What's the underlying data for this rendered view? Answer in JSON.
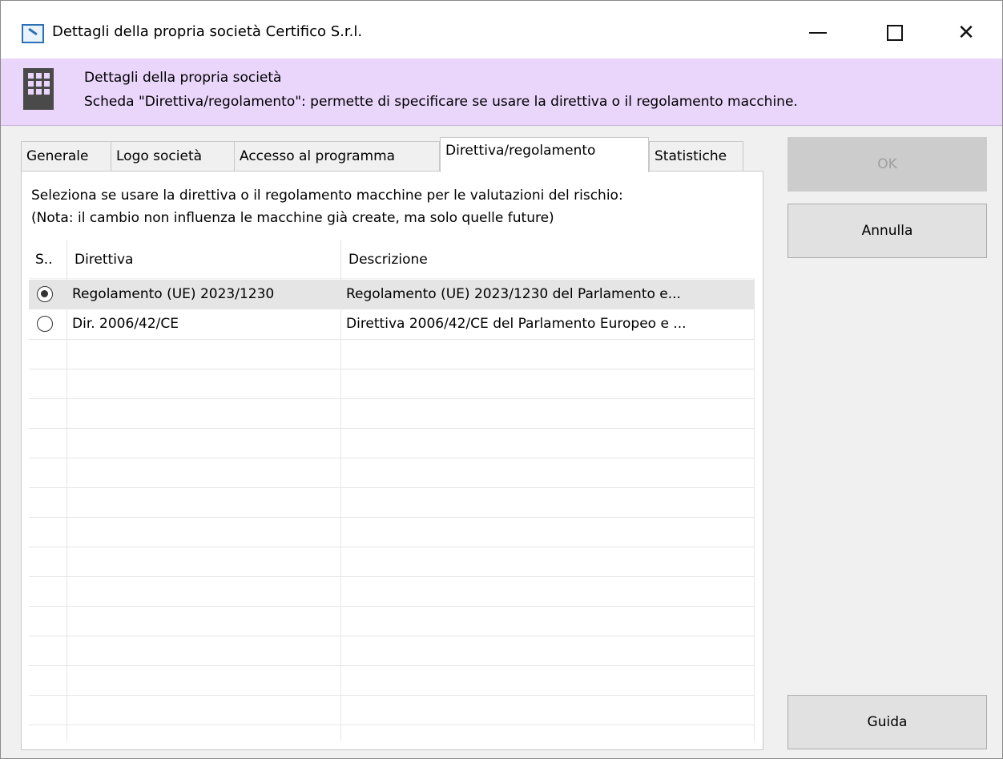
{
  "window": {
    "title": "Dettagli della propria società Certifico S.r.l.",
    "minimize_icon": "minimize-icon",
    "maximize_icon": "maximize-icon",
    "close_icon": "close-icon"
  },
  "header": {
    "icon": "building-icon",
    "title": "Dettagli della propria società",
    "description": "Scheda \"Direttiva/regolamento\": permette di specificare se usare la direttiva o il regolamento macchine.",
    "background": "#ead5fb"
  },
  "tabs": [
    {
      "label": "Generale",
      "active": false
    },
    {
      "label": "Logo società",
      "active": false
    },
    {
      "label": "Accesso al programma",
      "active": false
    },
    {
      "label": "Direttiva/regolamento",
      "active": true
    },
    {
      "label": "Statistiche",
      "active": false
    }
  ],
  "panel": {
    "instruction": "Seleziona se usare la direttiva o il regolamento macchine per le valutazioni del rischio:",
    "note": "(Nota: il cambio non influenza le macchine già create, ma solo quelle future)"
  },
  "list": {
    "columns": [
      "S..",
      "Direttiva",
      "Descrizione"
    ],
    "rows": [
      {
        "selected": true,
        "directive": "Regolamento (UE) 2023/1230",
        "description": "Regolamento (UE) 2023/1230 del Parlamento e..."
      },
      {
        "selected": false,
        "directive": "Dir. 2006/42/CE",
        "description": "Direttiva 2006/42/CE del Parlamento Europeo e ..."
      }
    ]
  },
  "buttons": {
    "ok": "OK",
    "cancel": "Annulla",
    "help": "Guida"
  }
}
